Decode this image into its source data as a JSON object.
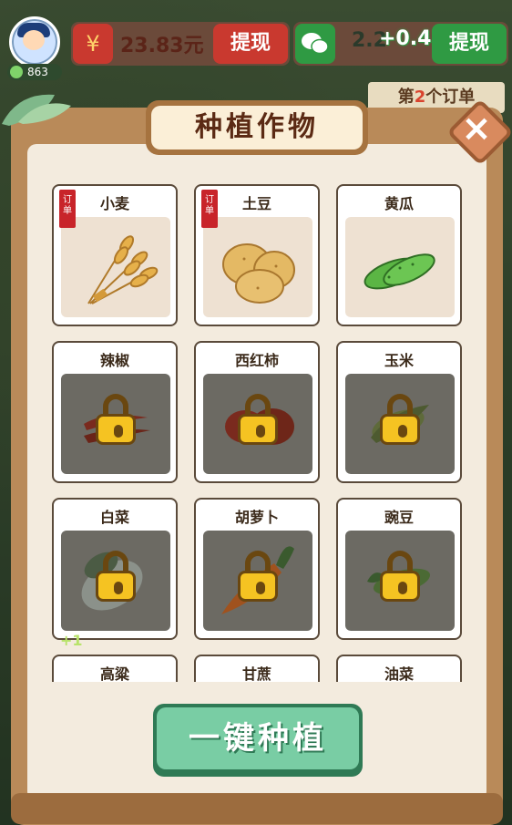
{
  "hud": {
    "gems": "863",
    "money_badge": "¥",
    "money_amount": "23.83元",
    "money_withdraw": "提现",
    "wechat_amount": "2.2",
    "wechat_plus": "+0.43",
    "wechat_withdraw": "提现"
  },
  "order": {
    "prefix": "第",
    "number": "2",
    "suffix": "个订单"
  },
  "panel": {
    "title": "种植作物",
    "close": "×",
    "plant_button": "一键种植",
    "bonus": "+1"
  },
  "crops": [
    {
      "name": "小麦",
      "order_tag": "订单",
      "locked": false,
      "icon": "wheat-icon"
    },
    {
      "name": "土豆",
      "order_tag": "订单",
      "locked": false,
      "icon": "potato-icon"
    },
    {
      "name": "黄瓜",
      "locked": false,
      "icon": "cucumber-icon"
    },
    {
      "name": "辣椒",
      "locked": true,
      "icon": "chili-icon"
    },
    {
      "name": "西红柿",
      "locked": true,
      "icon": "tomato-icon"
    },
    {
      "name": "玉米",
      "locked": true,
      "icon": "corn-icon"
    },
    {
      "name": "白菜",
      "locked": true,
      "icon": "cabbage-icon"
    },
    {
      "name": "胡萝卜",
      "locked": true,
      "icon": "carrot-icon"
    },
    {
      "name": "豌豆",
      "locked": true,
      "icon": "pea-icon"
    },
    {
      "name": "高粱",
      "locked": true,
      "icon": "sorghum-icon"
    },
    {
      "name": "甘蔗",
      "locked": true,
      "icon": "sugarcane-icon"
    },
    {
      "name": "油菜",
      "locked": true,
      "icon": "rapeseed-icon"
    }
  ]
}
